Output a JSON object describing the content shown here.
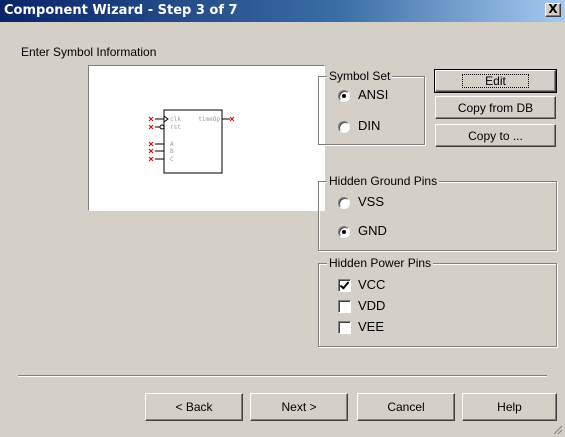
{
  "window": {
    "title": "Component Wizard - Step 3 of 7",
    "close_glyph": "X"
  },
  "section_label": "Enter Symbol Information",
  "symbol_preview": {
    "pins_left": [
      "clk",
      "rst",
      "A",
      "B",
      "C"
    ],
    "pins_right": [
      "timeOp"
    ],
    "pin_color": "#cc0000"
  },
  "symbol_set": {
    "title": "Symbol Set",
    "options": [
      {
        "label": "ANSI",
        "checked": true
      },
      {
        "label": "DIN",
        "checked": false
      }
    ]
  },
  "buttons": {
    "edit": "Edit",
    "copy_from_db": "Copy from DB",
    "copy_to": "Copy to ..."
  },
  "hidden_ground_pins": {
    "title": "Hidden Ground Pins",
    "options": [
      {
        "label": "VSS",
        "checked": false
      },
      {
        "label": "GND",
        "checked": true
      }
    ]
  },
  "hidden_power_pins": {
    "title": "Hidden Power Pins",
    "options": [
      {
        "label": "VCC",
        "checked": true
      },
      {
        "label": "VDD",
        "checked": false
      },
      {
        "label": "VEE",
        "checked": false
      }
    ]
  },
  "footer": {
    "back": "< Back",
    "next": "Next >",
    "cancel": "Cancel",
    "help": "Help"
  },
  "colors": {
    "dialog_bg": "#d4d0c8",
    "title_gradient_start": "#0a246a",
    "title_gradient_end": "#a6caf0"
  }
}
